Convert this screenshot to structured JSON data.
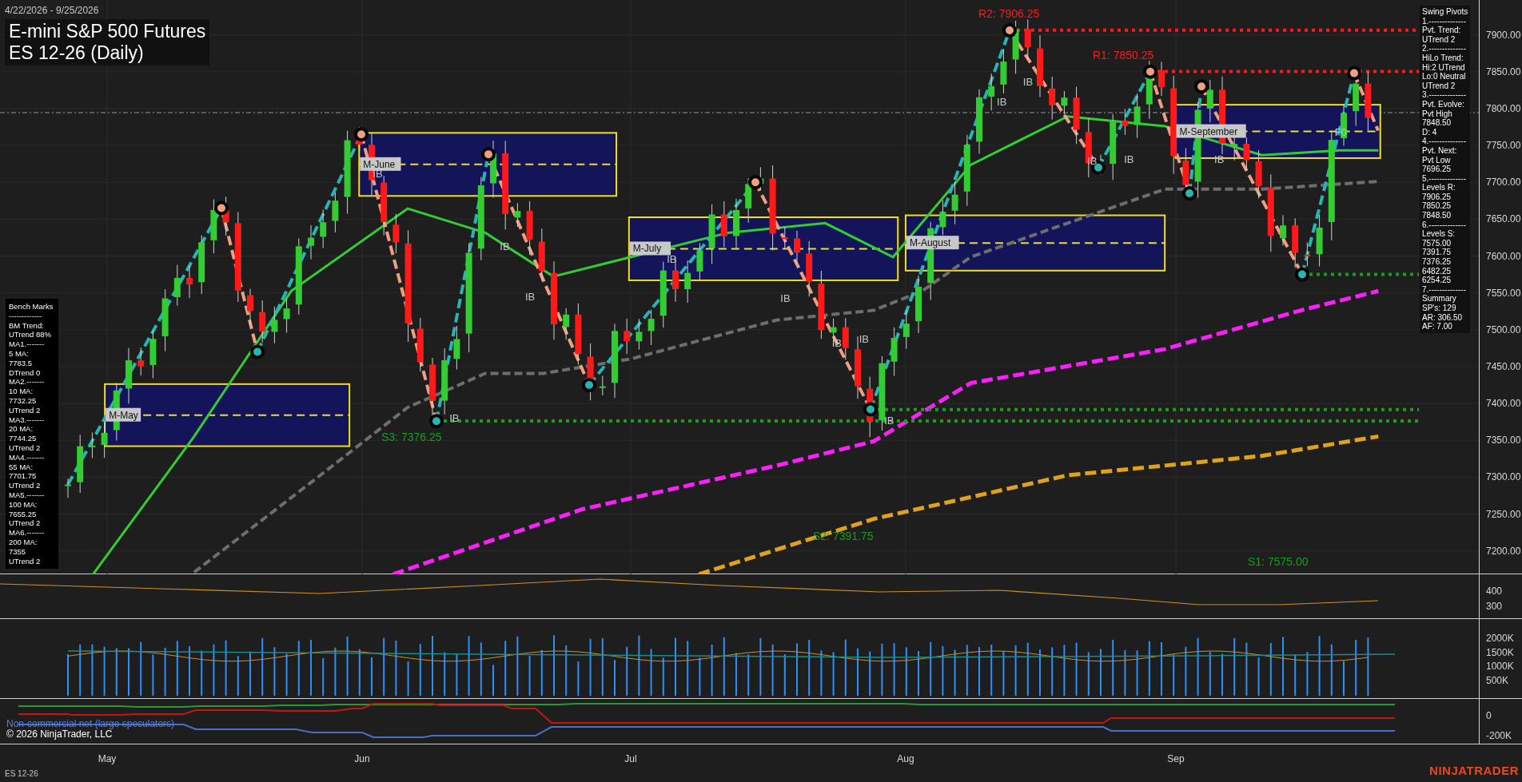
{
  "header": {
    "date_range": "4/22/2026 - 9/25/2026",
    "title": "E-mini S&P 500 Futures",
    "subtitle": "ES 12-26 (Daily)"
  },
  "price_axis": [
    "7900.00",
    "7850.00",
    "7800.00",
    "7750.00",
    "7700.00",
    "7650.00",
    "7600.00",
    "7550.00",
    "7500.00",
    "7450.00",
    "7400.00",
    "7350.00",
    "7300.00",
    "7250.00",
    "7200.00"
  ],
  "levels": [
    {
      "label": "R2: 7906.25",
      "kind": "resistance"
    },
    {
      "label": "R1: 7850.25",
      "kind": "resistance"
    },
    {
      "label": "S1: 7575.00",
      "kind": "support"
    },
    {
      "label": "S2: 7391.75",
      "kind": "support"
    },
    {
      "label": "S3: 7376.25",
      "kind": "support"
    }
  ],
  "month_boxes": [
    "M-May",
    "M-June",
    "M-July",
    "M-August",
    "M-September"
  ],
  "markers": [
    "IB",
    "IB",
    "IB",
    "IB",
    "IB",
    "IB",
    "IB",
    "IB",
    "IB",
    "IB",
    "IB",
    "IB",
    "IB",
    "IB",
    "F0"
  ],
  "swing_pivots": [
    "Swing Pivots",
    "1.--------------",
    "Pvt. Trend:",
    "UTrend 2",
    "2.--------------",
    "HiLo Trend:",
    "Hi:2 UTrend",
    "Lo:0 Neutral",
    "UTrend 2",
    "3.--------------",
    "Pvt. Evolve:",
    "Pvt High",
    "7848.50",
    "D: 4",
    "4.--------------",
    "Pvt. Next:",
    "Pvt Low",
    "7696.25",
    "5.--------------",
    "Levels R:",
    "7906.25",
    "7850.25",
    "7848.50",
    "6.--------------",
    "Levels S:",
    "7575.00",
    "7391.75",
    "7376.25",
    "6482.25",
    "6254.25",
    "7.--------------",
    "Summary",
    "SP's: 129",
    "AR: 306.50",
    "AF: 7.00"
  ],
  "bench_marks": [
    "Bench Marks",
    "-------------",
    "BM Trend:",
    "UTrend 88%",
    "MA1.-------",
    "5 MA:",
    "7783.5",
    "DTrend 0",
    "MA2.-------",
    "10 MA:",
    "7732.25",
    "UTrend 2",
    "MA3.-------",
    "20 MA:",
    "7744.25",
    "UTrend 2",
    "MA4.-------",
    "55 MA:",
    "7701.75",
    "UTrend 2",
    "MA5.-------",
    "100 MA:",
    "7655.25",
    "UTrend 2",
    "MA6.-------",
    "200 MA:",
    "7355",
    "UTrend 2"
  ],
  "atr_axis": [
    "400",
    "300"
  ],
  "volume_axis": [
    "2000K",
    "1500K",
    "1000K",
    "500K"
  ],
  "cot_axis": [
    "0",
    "-200K"
  ],
  "cot_legend": "Non-commercial net (large speculators)",
  "copyright": "© 2026 NinjaTrader, LLC",
  "months": [
    "May",
    "Jun",
    "Jul",
    "Aug",
    "Sep"
  ],
  "instrument_tag": "ES 12-26",
  "brand": "NINJATRADER"
}
